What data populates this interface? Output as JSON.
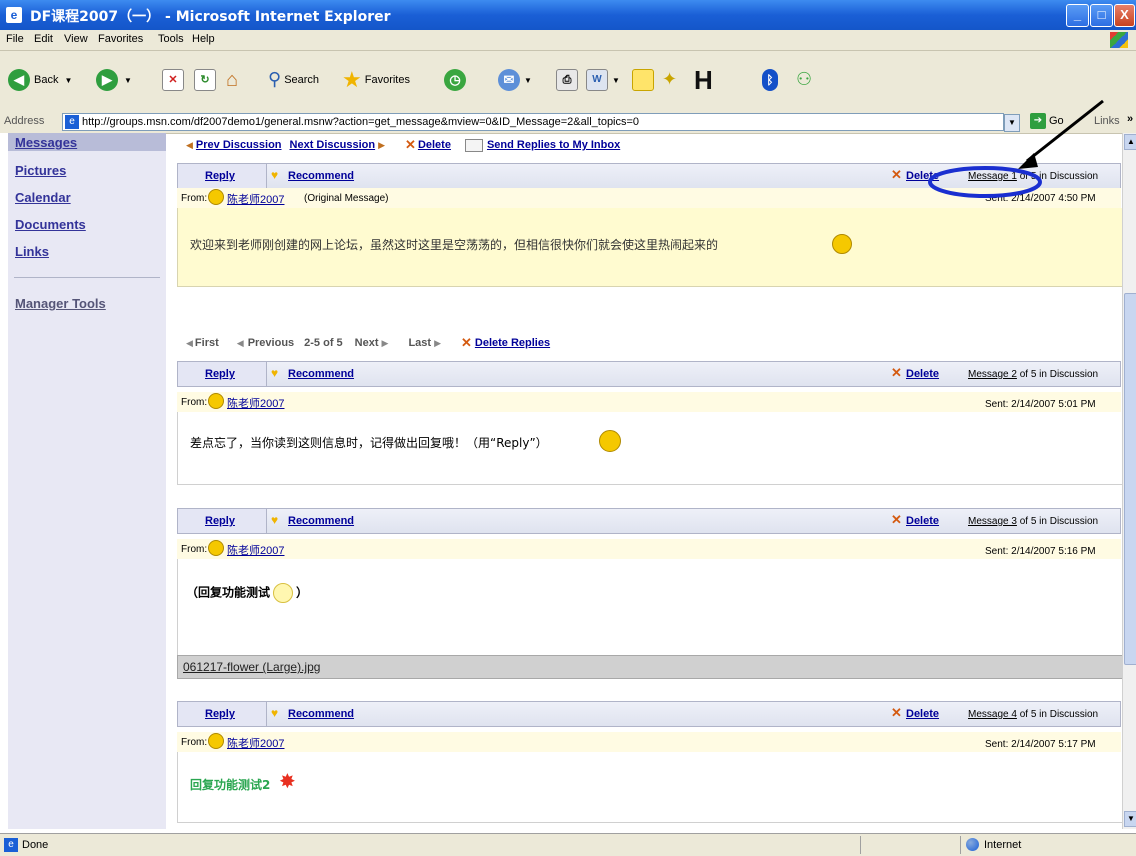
{
  "window": {
    "title": "DF课程2007（一） - Microsoft Internet Explorer",
    "minimize": "_",
    "maximize": "□",
    "close": "X"
  },
  "menu": [
    "File",
    "Edit",
    "View",
    "Favorites",
    "Tools",
    "Help"
  ],
  "toolbar": {
    "back": "Back",
    "search": "Search",
    "favorites": "Favorites"
  },
  "address": {
    "label": "Address",
    "url": "http://groups.msn.com/df2007demo1/general.msnw?action=get_message&mview=0&ID_Message=2&all_topics=0",
    "go": "Go",
    "links": "Links"
  },
  "sidebar": {
    "items": [
      "Messages",
      "Pictures",
      "Calendar",
      "Documents",
      "Links"
    ],
    "manager": "Manager Tools"
  },
  "discussion_nav": {
    "prev": "Prev Discussion",
    "next": "Next Discussion",
    "delete": "Delete",
    "send": "Send Replies to My Inbox"
  },
  "reply_nav": {
    "first": "First",
    "previous": "Previous",
    "range": "2-5 of 5",
    "next": "Next",
    "last": "Last",
    "delete_replies": "Delete Replies"
  },
  "messages": [
    {
      "reply": "Reply",
      "recommend": "Recommend",
      "delete": "Delete",
      "msgnum_link": "Message 1",
      "msgnum_rest": " of 5 in Discussion",
      "from_label": "From:",
      "author": "陈老师2007",
      "note": "(Original Message)",
      "sent": "Sent: 2/14/2007 4:50 PM",
      "body": "欢迎来到老师刚创建的网上论坛，虽然这时这里是空荡荡的，但相信很快你们就会使这里热闹起来的"
    },
    {
      "reply": "Reply",
      "recommend": "Recommend",
      "delete": "Delete",
      "msgnum_link": "Message 2",
      "msgnum_rest": " of 5 in Discussion",
      "from_label": "From:",
      "author": "陈老师2007",
      "sent": "Sent: 2/14/2007 5:01 PM",
      "body": "差点忘了，当你读到这则信息时，记得做出回复哦！（用“Reply”）"
    },
    {
      "reply": "Reply",
      "recommend": "Recommend",
      "delete": "Delete",
      "msgnum_link": "Message 3",
      "msgnum_rest": " of 5 in Discussion",
      "from_label": "From:",
      "author": "陈老师2007",
      "sent": "Sent: 2/14/2007 5:16 PM",
      "body": "（回复功能测试",
      "body_end": "）",
      "attachment": "061217-flower (Large).jpg"
    },
    {
      "reply": "Reply",
      "recommend": "Recommend",
      "delete": "Delete",
      "msgnum_link": "Message 4",
      "msgnum_rest": " of 5 in Discussion",
      "from_label": "From:",
      "author": "陈老师2007",
      "sent": "Sent: 2/14/2007 5:17 PM",
      "body": "回复功能测试2"
    }
  ],
  "status": {
    "left": "Done",
    "zone": "Internet"
  },
  "colors": {
    "titlebar": "#1a5fd6",
    "link": "#000099",
    "sidebar_link": "#333399",
    "highlight_circle": "#1a2fd0",
    "message_bg": "#fffbe3"
  }
}
